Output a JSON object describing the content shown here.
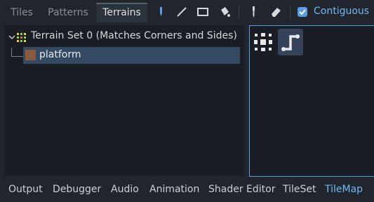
{
  "tabs": [
    "Tiles",
    "Patterns",
    "Terrains"
  ],
  "active_tab": "Terrains",
  "toolbar": {
    "tools": [
      "paint-brush-icon",
      "line-icon",
      "rect-icon",
      "bucket-fill-icon",
      "picker-icon",
      "eraser-icon"
    ],
    "contiguous_label": "Contiguous",
    "contiguous_checked": true
  },
  "terrain_tree": {
    "set_label": "Terrain Set 0 (Matches Corners and Sides)",
    "terrain_label": "platform",
    "terrain_color": "#8a5a3e"
  },
  "bottom_tabs": [
    "Output",
    "Debugger",
    "Audio",
    "Animation",
    "Shader Editor",
    "TileSet",
    "TileMap"
  ],
  "bottom_active": "TileMap",
  "colors": {
    "accent": "#70b7f3",
    "panel_bg": "#1a1e24",
    "selection": "#344a63"
  }
}
